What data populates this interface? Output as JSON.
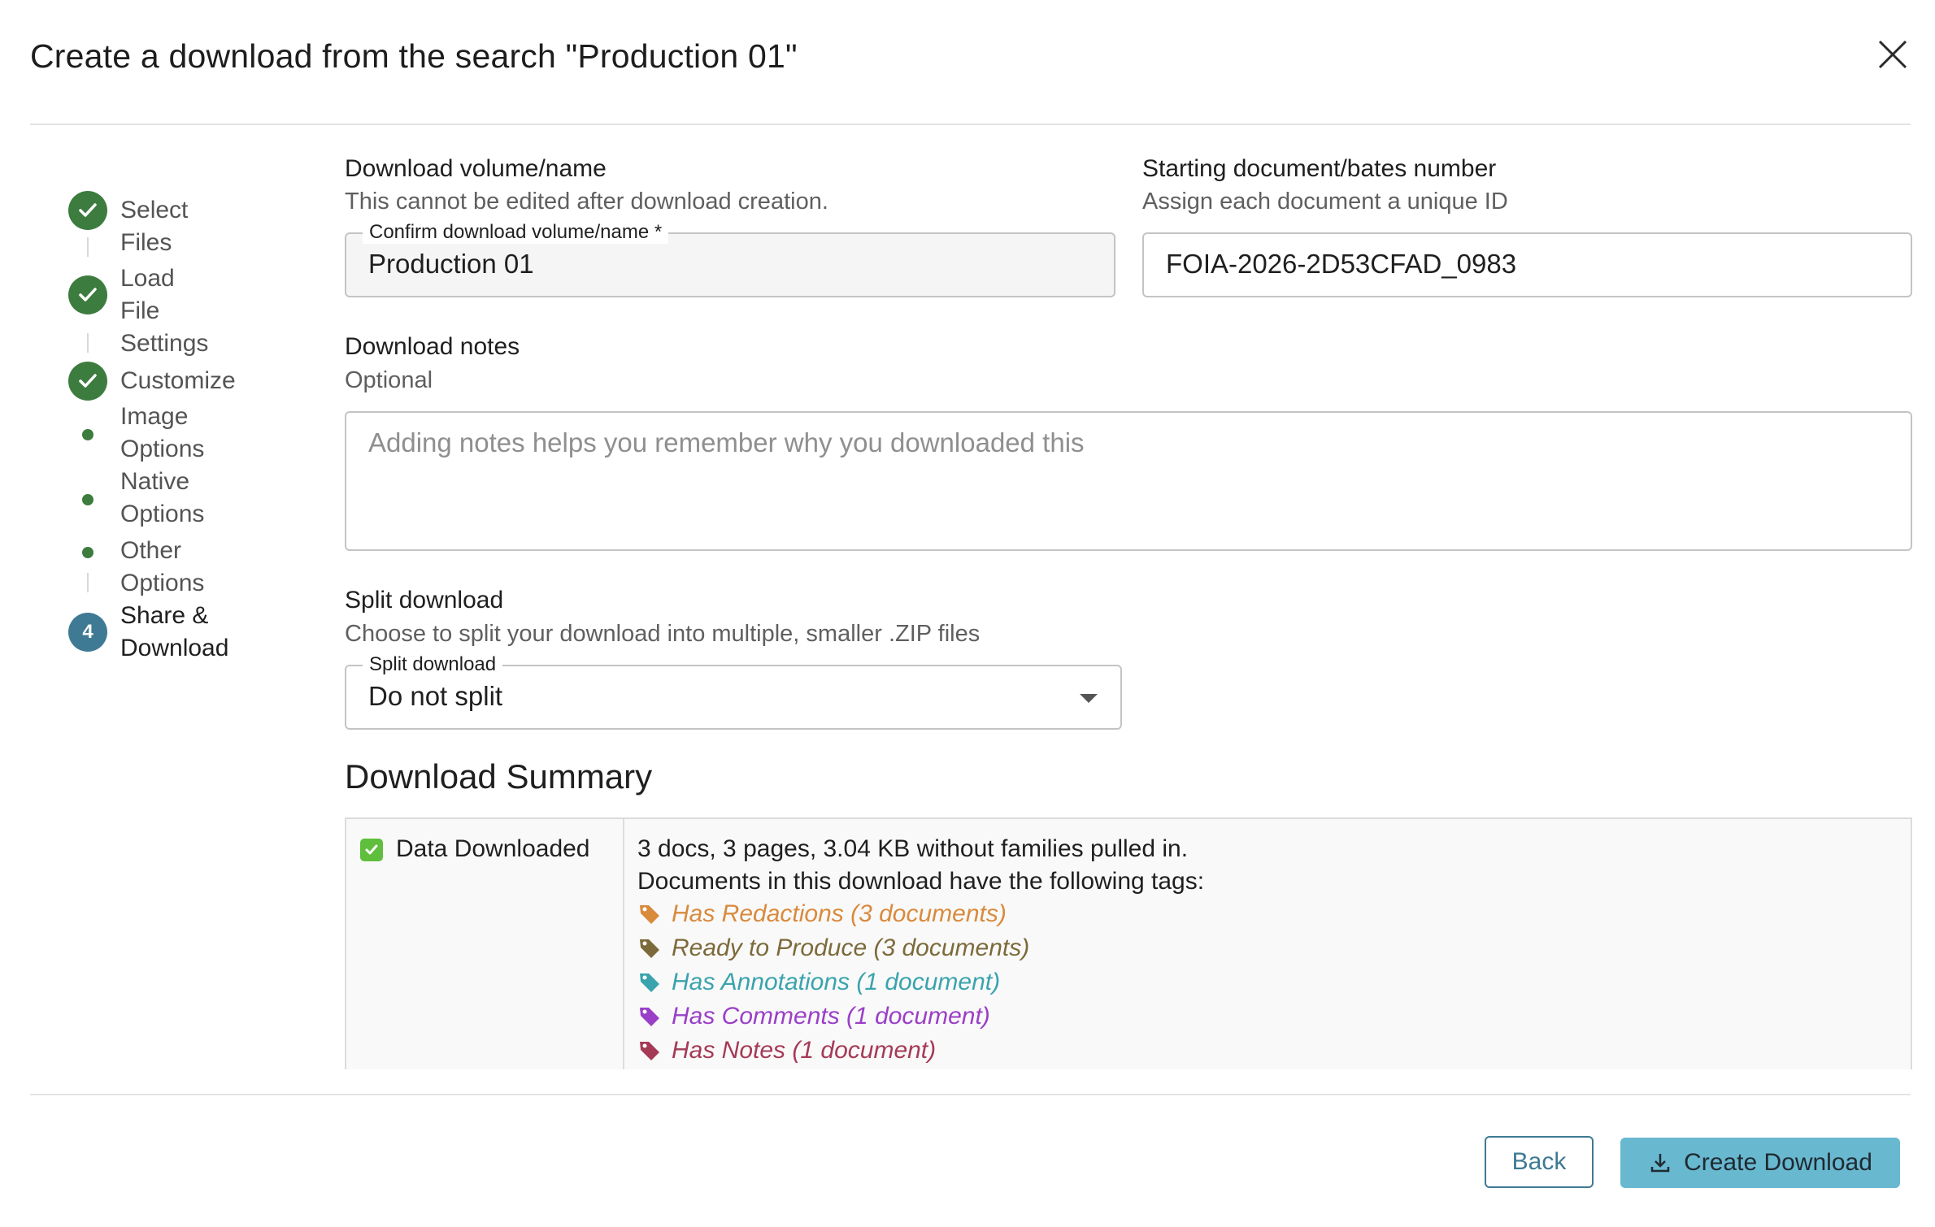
{
  "dialog": {
    "title": "Create a download from the search \"Production 01\""
  },
  "stepper": {
    "steps": [
      {
        "label": "Select Files",
        "state": "done"
      },
      {
        "label": "Load File Settings",
        "state": "done"
      },
      {
        "label": "Customize",
        "state": "done"
      },
      {
        "label": "Share & Download",
        "state": "active",
        "number": "4"
      }
    ],
    "sub_steps": [
      "Image Options",
      "Native Options",
      "Other Options"
    ],
    "load_file_line1": "Load File",
    "load_file_line2": "Settings",
    "image_line1": "Image",
    "image_line2": "Options",
    "native_line1": "Native",
    "native_line2": "Options",
    "share_line1": "Share &",
    "share_line2": "Download"
  },
  "form": {
    "volume": {
      "label": "Download volume/name",
      "help": "This cannot be edited after download creation.",
      "field_label": "Confirm download volume/name *",
      "value": "Production 01"
    },
    "bates": {
      "label": "Starting document/bates number",
      "help": "Assign each document a unique ID",
      "value": "FOIA-2026-2D53CFAD_0983"
    },
    "notes": {
      "label": "Download notes",
      "help": "Optional",
      "placeholder": "Adding notes helps you remember why you downloaded this"
    },
    "split": {
      "label": "Split download",
      "help": "Choose to split your download into multiple, smaller .ZIP files",
      "field_label": "Split download",
      "value": "Do not split"
    }
  },
  "summary": {
    "heading": "Download Summary",
    "row_title": "Data Downloaded",
    "line1": "3 docs, 3 pages, 3.04 KB without families pulled in.",
    "line2": "Documents in this download have the following tags:",
    "tags": [
      {
        "label": "Has Redactions (3 documents)",
        "color": "#d98a3d"
      },
      {
        "label": "Ready to Produce (3 documents)",
        "color": "#7c6a3a"
      },
      {
        "label": "Has Annotations (1 document)",
        "color": "#3aa3ad"
      },
      {
        "label": "Has Comments (1 document)",
        "color": "#9a3fc7"
      },
      {
        "label": "Has Notes (1 document)",
        "color": "#a53a57"
      }
    ]
  },
  "footer": {
    "back_label": "Back",
    "create_label": "Create Download"
  },
  "colors": {
    "done": "#3d7c3f",
    "active": "#3e7a93",
    "primary_button": "#68b8d0"
  }
}
